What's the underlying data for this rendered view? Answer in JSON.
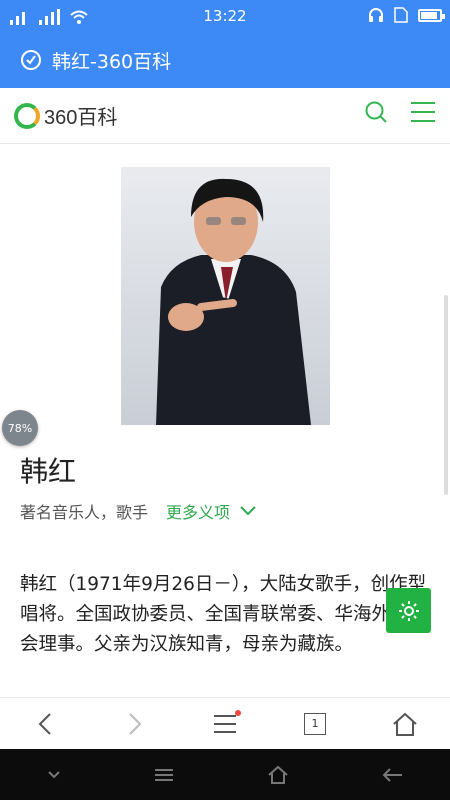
{
  "status_bar": {
    "time": "13:22",
    "battery_level": 0.8
  },
  "title_bar": {
    "title": "韩红-360百科"
  },
  "site": {
    "logo_text": "360百科"
  },
  "article": {
    "reading_progress": "78%",
    "title": "韩红",
    "subtitle": "著名音乐人，歌手",
    "more_meanings": "更多义项",
    "summary": "韩红（1971年9月26日－），大陆女歌手，创作型唱将。全国政协委员、全国青联常委、华海外联谊会理事。父亲为汉族知青，母亲为藏族。"
  },
  "toolbar": {
    "tab_count": "1"
  },
  "colors": {
    "brand_blue": "#3d8af7",
    "green": "#22b243"
  }
}
